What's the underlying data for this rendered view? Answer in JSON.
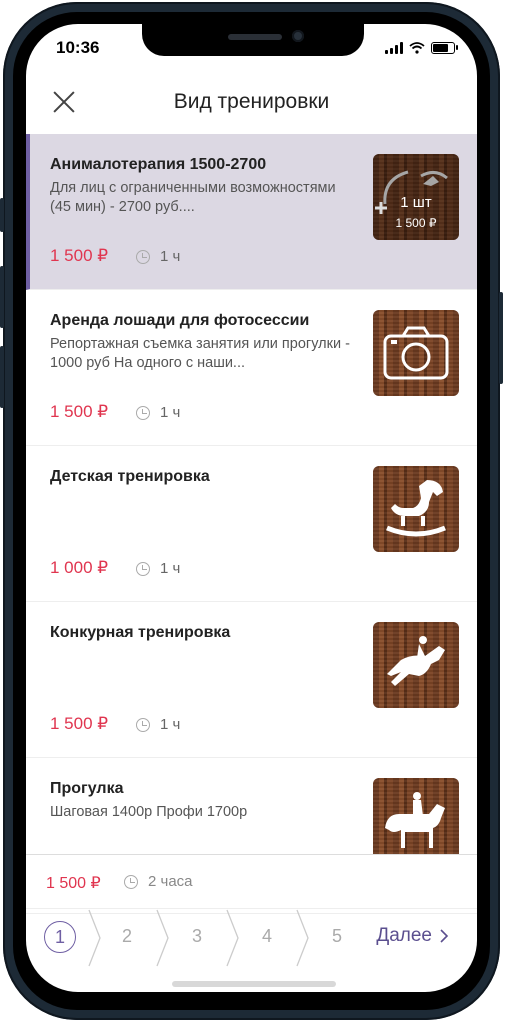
{
  "status": {
    "time": "10:36"
  },
  "header": {
    "title": "Вид тренировки"
  },
  "items": [
    {
      "name": "Анималотерапия 1500-2700",
      "desc": "Для лиц с ограниченными возможностями (45 мин) - 2700 руб....",
      "price": "1 500 ₽",
      "duration": "1 ч",
      "icon": "horse-therapy-icon",
      "selected": true,
      "qty": "1 шт",
      "qty_price": "1 500 ₽"
    },
    {
      "name": "Аренда лошади для фотосессии",
      "desc": "Репортажная съемка занятия или прогулки - 1000 руб На одного с наши...",
      "price": "1 500 ₽",
      "duration": "1 ч",
      "icon": "camera-icon"
    },
    {
      "name": "Детская тренировка",
      "desc": "",
      "price": "1 000 ₽",
      "duration": "1 ч",
      "icon": "rocking-horse-icon"
    },
    {
      "name": "Конкурная тренировка",
      "desc": "",
      "price": "1 500 ₽",
      "duration": "1 ч",
      "icon": "jumping-horse-icon"
    },
    {
      "name": "Прогулка",
      "desc": "Шаговая 1400р Профи 1700р",
      "price": "",
      "duration": "",
      "icon": "walking-horse-icon"
    }
  ],
  "summary": {
    "price": "1 500 ₽",
    "duration": "2 часа"
  },
  "steps": [
    "1",
    "2",
    "3",
    "4",
    "5"
  ],
  "next_label": "Далее",
  "colors": {
    "accent": "#6f5fa3",
    "price": "#e0354f",
    "selected_bg": "#dcd8e3"
  }
}
